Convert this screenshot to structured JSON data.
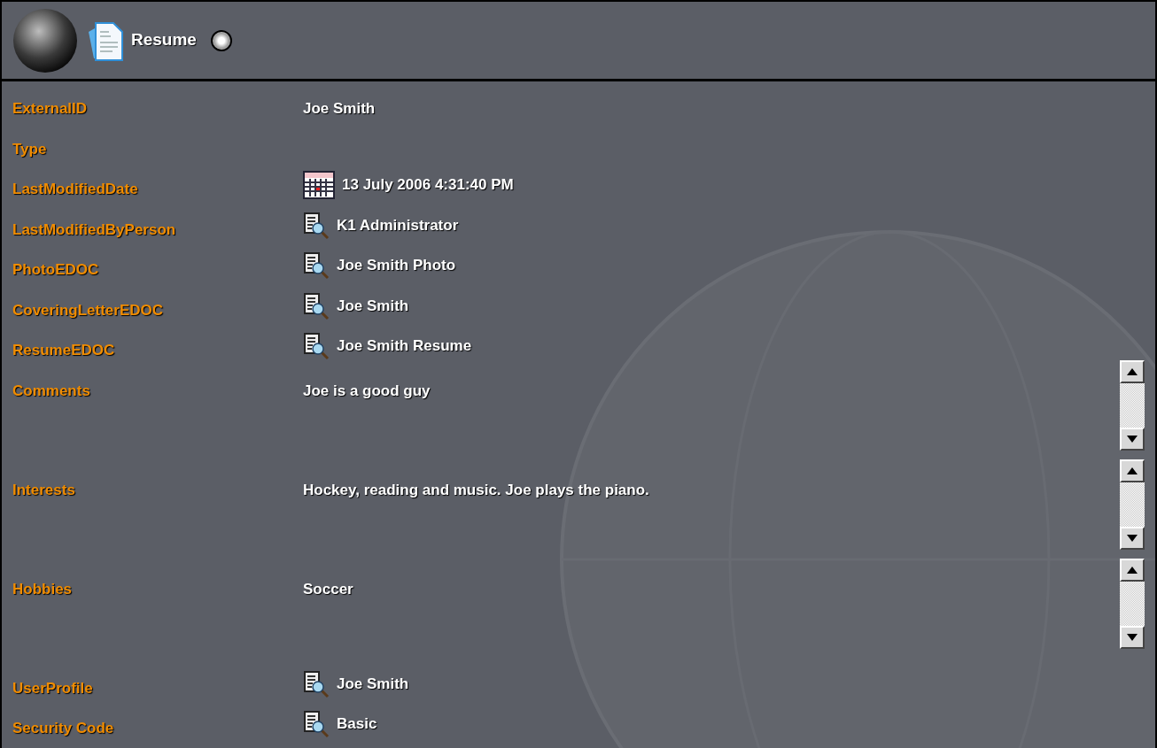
{
  "header": {
    "title": "Resume",
    "radio_selected": false
  },
  "fields": [
    {
      "kind": "text",
      "label": "ExternalID",
      "value": "Joe Smith"
    },
    {
      "kind": "text",
      "label": "Type"
    },
    {
      "kind": "date",
      "label": "LastModifiedDate",
      "value": "13 July 2006 4:31:40 PM"
    },
    {
      "kind": "link",
      "label": "LastModifiedByPerson",
      "value": "K1 Administrator"
    },
    {
      "kind": "link",
      "label": "PhotoEDOC",
      "value": "Joe Smith Photo"
    },
    {
      "kind": "link",
      "label": "CoveringLetterEDOC",
      "value": "Joe Smith"
    },
    {
      "kind": "link",
      "label": "ResumeEDOC",
      "value": "Joe Smith Resume"
    },
    {
      "kind": "memo",
      "label": "Comments",
      "value": "Joe is a good guy"
    },
    {
      "kind": "memo",
      "label": "Interests",
      "value": "Hockey, reading and music. Joe plays the piano."
    },
    {
      "kind": "memo",
      "label": "Hobbies",
      "value": "Soccer"
    },
    {
      "kind": "link",
      "label": "UserProfile",
      "value": "Joe Smith"
    },
    {
      "kind": "link",
      "label": "Security Code",
      "value": "Basic"
    }
  ]
}
